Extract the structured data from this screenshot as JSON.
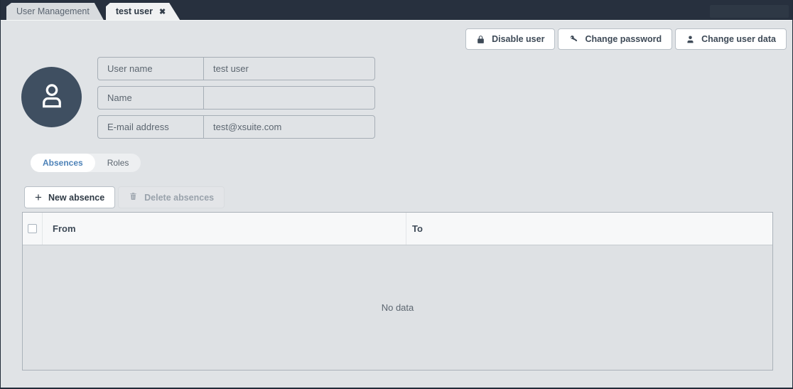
{
  "tab_bar": {
    "tabs": [
      {
        "label": "User Management",
        "active": false
      },
      {
        "label": "test user",
        "active": true
      }
    ]
  },
  "icons": {
    "close": "✖",
    "plus": "+"
  },
  "toolbar": {
    "buttons": [
      {
        "label": "Disable user",
        "icon": "lock-icon"
      },
      {
        "label": "Change password",
        "icon": "key-icon"
      },
      {
        "label": "Change user data",
        "icon": "person-icon"
      }
    ]
  },
  "profile": {
    "avatar_icon": "person-outline-icon",
    "fields": [
      {
        "label": "User name",
        "value": "test user"
      },
      {
        "label": "Name",
        "value": ""
      },
      {
        "label": "E-mail address",
        "value": "test@xsuite.com"
      }
    ]
  },
  "section_tabs": [
    {
      "label": "Absences",
      "active": true
    },
    {
      "label": "Roles",
      "active": false
    }
  ],
  "absence_toolbar": {
    "new_label": "New absence",
    "delete_label": "Delete absences"
  },
  "table": {
    "columns": [
      "From",
      "To"
    ],
    "rows": [],
    "empty_text": "No data"
  },
  "colors": {
    "tab_bar_bg": "#27303e",
    "content_bg": "#e0e3e6",
    "avatar_bg": "#3f4f61",
    "accent_blue": "#4d82b8",
    "header_bg": "#f7f8f9"
  }
}
